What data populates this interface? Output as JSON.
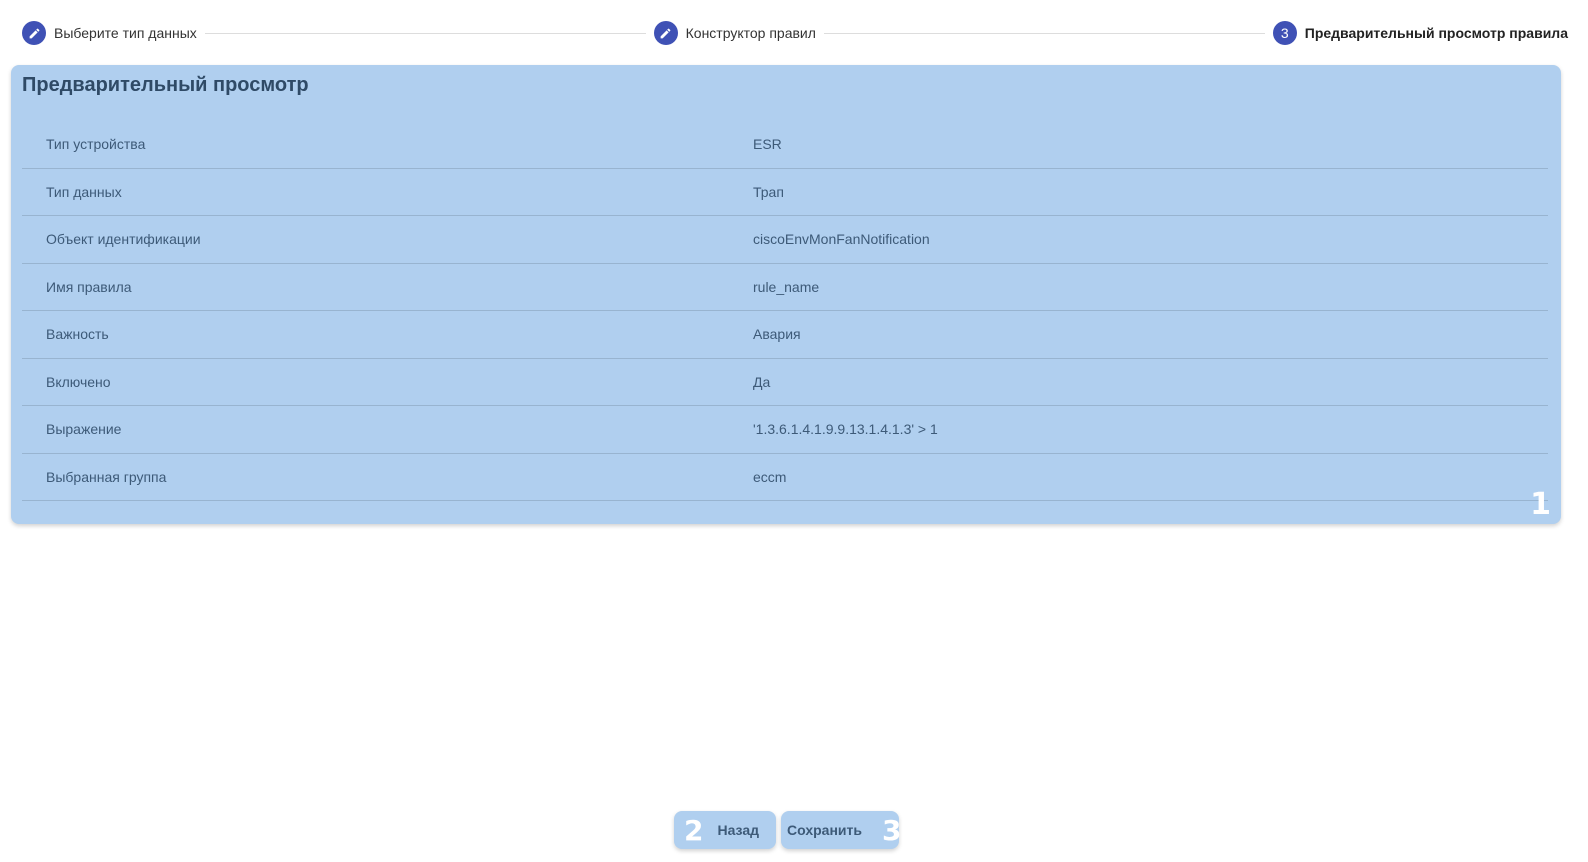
{
  "stepper": {
    "steps": [
      {
        "icon": "pencil-icon",
        "label": "Выберите тип данных"
      },
      {
        "icon": "pencil-icon",
        "label": "Конструктор правил"
      },
      {
        "number": "3",
        "label": "Предварительный просмотр правила"
      }
    ],
    "accent_color": "#3f51b5"
  },
  "preview": {
    "title": "Предварительный просмотр",
    "badge": "1",
    "rows": [
      {
        "label": "Тип устройства",
        "value": "ESR"
      },
      {
        "label": "Тип данных",
        "value": "Трап"
      },
      {
        "label": "Объект идентификации",
        "value": "ciscoEnvMonFanNotification"
      },
      {
        "label": "Имя правила",
        "value": "rule_name"
      },
      {
        "label": "Важность",
        "value": "Авария"
      },
      {
        "label": "Включено",
        "value": "Да"
      },
      {
        "label": "Выражение",
        "value": "'1.3.6.1.4.1.9.9.13.1.4.1.3' > 1"
      },
      {
        "label": "Выбранная группа",
        "value": "eccm"
      }
    ]
  },
  "actions": {
    "back_label": "Назад",
    "back_badge": "2",
    "save_label": "Сохранить",
    "save_badge": "3"
  },
  "colors": {
    "highlight": "#b0cfef",
    "text": "#3d5a78"
  }
}
